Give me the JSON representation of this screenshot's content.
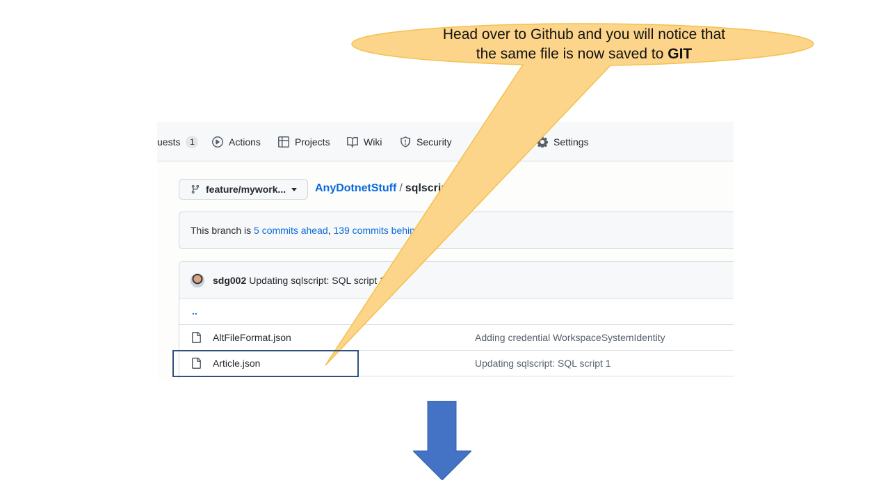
{
  "callout": {
    "line1": "Head over to Github and you will notice that",
    "line2_prefix": "the same file is now saved to ",
    "line2_bold": "GIT",
    "fill_color": "#fdd58a",
    "stroke_color": "#f2c14e"
  },
  "nav": {
    "pull_requests_partial": "uests",
    "pull_requests_count": "1",
    "actions": "Actions",
    "projects": "Projects",
    "wiki": "Wiki",
    "security": "Security",
    "settings": "Settings"
  },
  "branch_selector": {
    "label": "feature/mywork..."
  },
  "breadcrumb": {
    "repo": "AnyDotnetStuff",
    "separator": "/",
    "folder": "sqlscript"
  },
  "branch_info": {
    "prefix": "This branch is ",
    "ahead": "5 commits ahead",
    "comma": ", ",
    "behind": "139 commits behind"
  },
  "latest_commit": {
    "author": "sdg002",
    "message": "Updating sqlscript: SQL script 1"
  },
  "files": {
    "parent": "..",
    "rows": [
      {
        "name": "AltFileFormat.json",
        "message": "Adding credential WorkspaceSystemIdentity"
      },
      {
        "name": "Article.json",
        "message": "Updating sqlscript: SQL script 1"
      }
    ]
  },
  "colors": {
    "link": "#0969da",
    "arrow": "#4472c4",
    "highlight_border": "#2f4f7f"
  }
}
